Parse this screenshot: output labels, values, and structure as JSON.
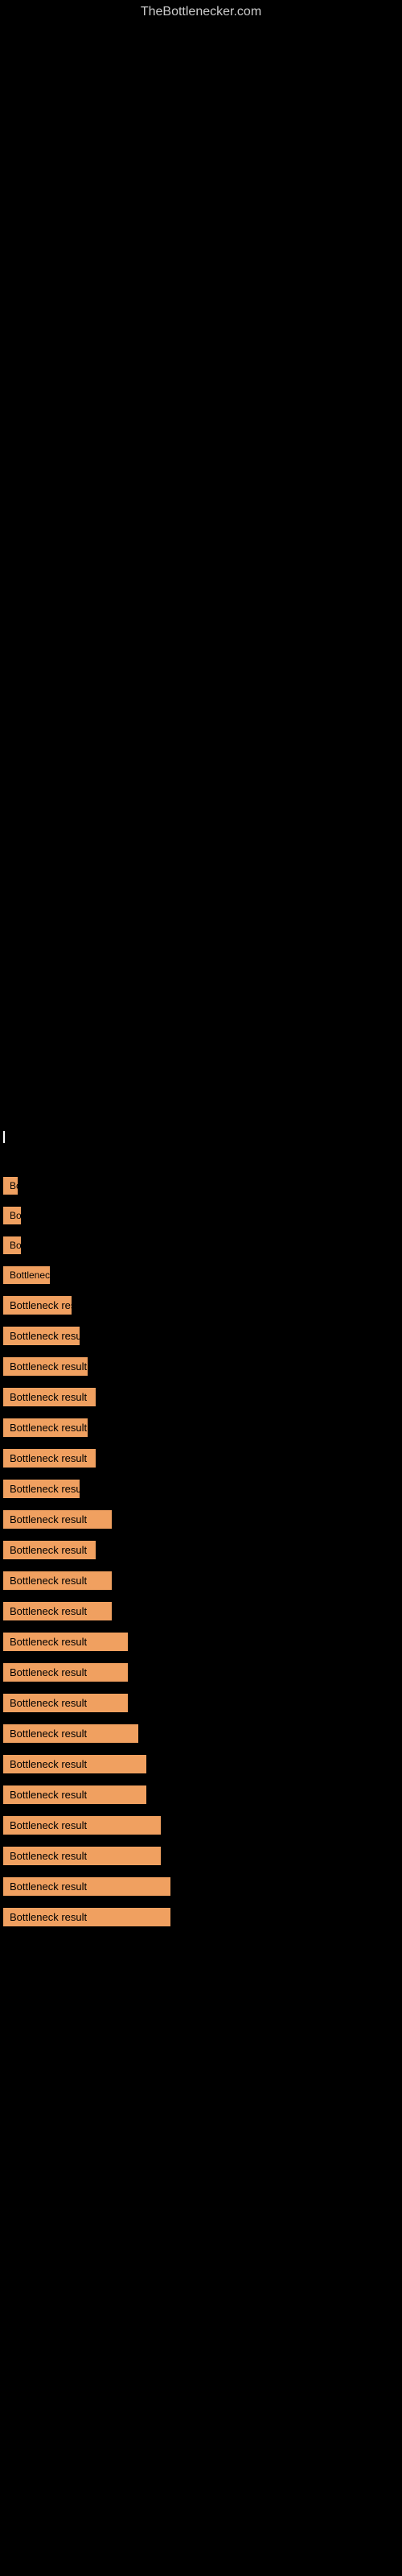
{
  "site": {
    "title": "TheBottlenecker.com"
  },
  "results": [
    {
      "label": "Bottleneck result",
      "width_class": "w-10",
      "id": 1
    },
    {
      "label": "Bottleneck result",
      "width_class": "w-15",
      "id": 2
    },
    {
      "label": "Bottleneck result",
      "width_class": "w-15",
      "id": 3
    },
    {
      "label": "Bottleneck result",
      "width_class": "w-50",
      "id": 4
    },
    {
      "label": "Bottleneck result",
      "width_class": "w-80",
      "id": 5
    },
    {
      "label": "Bottleneck result",
      "width_class": "w-90",
      "id": 6
    },
    {
      "label": "Bottleneck result",
      "width_class": "w-100",
      "id": 7
    },
    {
      "label": "Bottleneck result",
      "width_class": "w-110",
      "id": 8
    },
    {
      "label": "Bottleneck result",
      "width_class": "w-100",
      "id": 9
    },
    {
      "label": "Bottleneck result",
      "width_class": "w-110",
      "id": 10
    },
    {
      "label": "Bottleneck result",
      "width_class": "w-90",
      "id": 11
    },
    {
      "label": "Bottleneck result",
      "width_class": "w-130",
      "id": 12
    },
    {
      "label": "Bottleneck result",
      "width_class": "w-110",
      "id": 13
    },
    {
      "label": "Bottleneck result",
      "width_class": "w-130",
      "id": 14
    },
    {
      "label": "Bottleneck result",
      "width_class": "w-130",
      "id": 15
    },
    {
      "label": "Bottleneck result",
      "width_class": "w-150",
      "id": 16
    },
    {
      "label": "Bottleneck result",
      "width_class": "w-150",
      "id": 17
    },
    {
      "label": "Bottleneck result",
      "width_class": "w-150",
      "id": 18
    },
    {
      "label": "Bottleneck result",
      "width_class": "w-160",
      "id": 19
    },
    {
      "label": "Bottleneck result",
      "width_class": "w-170",
      "id": 20
    },
    {
      "label": "Bottleneck result",
      "width_class": "w-170",
      "id": 21
    },
    {
      "label": "Bottleneck result",
      "width_class": "w-190",
      "id": 22
    },
    {
      "label": "Bottleneck result",
      "width_class": "w-190",
      "id": 23
    },
    {
      "label": "Bottleneck result",
      "width_class": "w-200",
      "id": 24
    },
    {
      "label": "Bottleneck result",
      "width_class": "w-200",
      "id": 25
    }
  ]
}
